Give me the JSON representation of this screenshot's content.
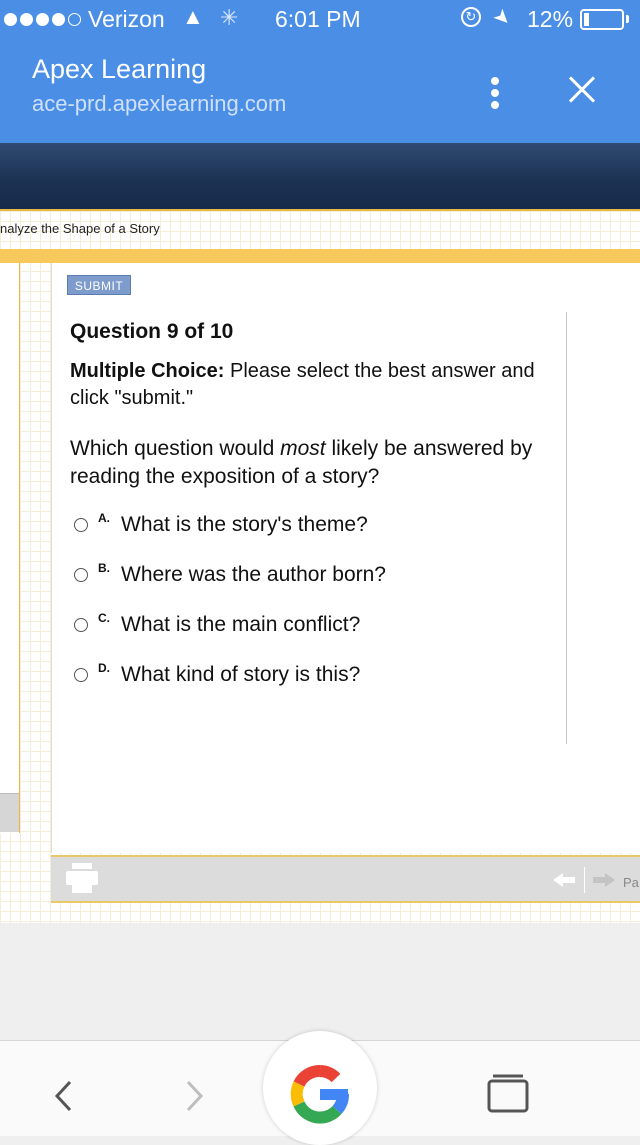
{
  "status_bar": {
    "carrier": "Verizon",
    "time": "6:01 PM",
    "battery": "12%"
  },
  "browser": {
    "site_title": "Apex Learning",
    "url": "ace-prd.apexlearning.com"
  },
  "lesson": {
    "title": "nalyze the Shape of a Story"
  },
  "quiz": {
    "submit_label": "SUBMIT",
    "question_number": "Question 9 of 10",
    "instruction_bold": "Multiple Choice:",
    "instruction_rest": " Please select the best answer and click \"submit.\"",
    "question_before": "Which question would ",
    "question_emphasis": "most",
    "question_after": " likely be answered by reading the exposition of a story?",
    "choices": [
      {
        "letter": "A.",
        "text": "What is the story's theme?"
      },
      {
        "letter": "B.",
        "text": "Where was the author born?"
      },
      {
        "letter": "C.",
        "text": "What is the main conflict?"
      },
      {
        "letter": "D.",
        "text": "What kind of story is this?"
      }
    ]
  },
  "footer": {
    "page_label": "Pa"
  },
  "icons": {
    "menu": "more-vert-icon",
    "close": "close-icon",
    "print": "printer-icon",
    "back": "chevron-left-icon",
    "forward": "chevron-right-icon",
    "tabs": "tabs-icon",
    "search": "google-logo"
  },
  "colors": {
    "browser_header": "#4a8ee6",
    "banner": "#1d3354",
    "accent_yellow": "#f7c85c",
    "submit_button": "#7d9bcb"
  }
}
